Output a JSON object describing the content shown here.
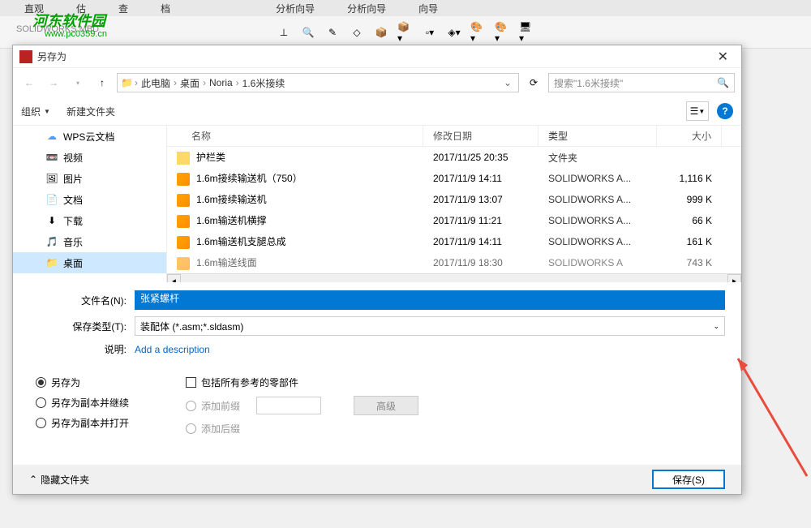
{
  "topTabs": [
    "直观",
    "估",
    "查",
    "档",
    "分析向导",
    "分析向导",
    "向导"
  ],
  "watermark": "河东软件园",
  "watermarkUrl": "www.pc0359.cn",
  "swLabel": "SOLIDWORKS MBD",
  "dialog": {
    "title": "另存为",
    "breadcrumb": [
      "此电脑",
      "桌面",
      "Noria",
      "1.6米接续"
    ],
    "searchPlaceholder": "搜索\"1.6米接续\"",
    "organize": "组织",
    "newFolder": "新建文件夹"
  },
  "sidebar": {
    "items": [
      {
        "label": "WPS云文档",
        "icon": "☁"
      },
      {
        "label": "视频",
        "icon": "📼"
      },
      {
        "label": "图片",
        "icon": "🖼"
      },
      {
        "label": "文档",
        "icon": "📄"
      },
      {
        "label": "下载",
        "icon": "⬇"
      },
      {
        "label": "音乐",
        "icon": "🎵"
      },
      {
        "label": "桌面",
        "icon": "📁",
        "selected": true
      }
    ]
  },
  "fileList": {
    "headers": {
      "name": "名称",
      "date": "修改日期",
      "type": "类型",
      "size": "大小"
    },
    "files": [
      {
        "name": "护栏类",
        "date": "2017/11/25 20:35",
        "type": "文件夹",
        "size": "",
        "icon": "folder"
      },
      {
        "name": "1.6m接续输送机（750）",
        "date": "2017/11/9 14:11",
        "type": "SOLIDWORKS A...",
        "size": "1,116 K",
        "icon": "asm"
      },
      {
        "name": "1.6m接续输送机",
        "date": "2017/11/9 13:07",
        "type": "SOLIDWORKS A...",
        "size": "999 K",
        "icon": "asm"
      },
      {
        "name": "1.6m输送机横撑",
        "date": "2017/11/9 11:21",
        "type": "SOLIDWORKS A...",
        "size": "66 K",
        "icon": "asm"
      },
      {
        "name": "1.6m输送机支腿总成",
        "date": "2017/11/9 14:11",
        "type": "SOLIDWORKS A...",
        "size": "161 K",
        "icon": "asm"
      },
      {
        "name": "1.6m输送线面",
        "date": "2017/11/9 18:30",
        "type": "SOLIDWORKS A",
        "size": "743 K",
        "icon": "asm"
      }
    ]
  },
  "form": {
    "filenameLabel": "文件名(N):",
    "filenameValue": "张紧螺杆",
    "filetypeLabel": "保存类型(T):",
    "filetypeValue": "装配体 (*.asm;*.sldasm)",
    "descLabel": "说明:",
    "descLink": "Add a description"
  },
  "options": {
    "radio1": "另存为",
    "radio2": "另存为副本并继续",
    "radio3": "另存为副本并打开",
    "checkbox1": "包括所有参考的零部件",
    "subRadio1": "添加前缀",
    "subRadio2": "添加后缀",
    "advBtn": "高级"
  },
  "footer": {
    "hideFolders": "隐藏文件夹",
    "saveBtn": "保存(S)"
  }
}
